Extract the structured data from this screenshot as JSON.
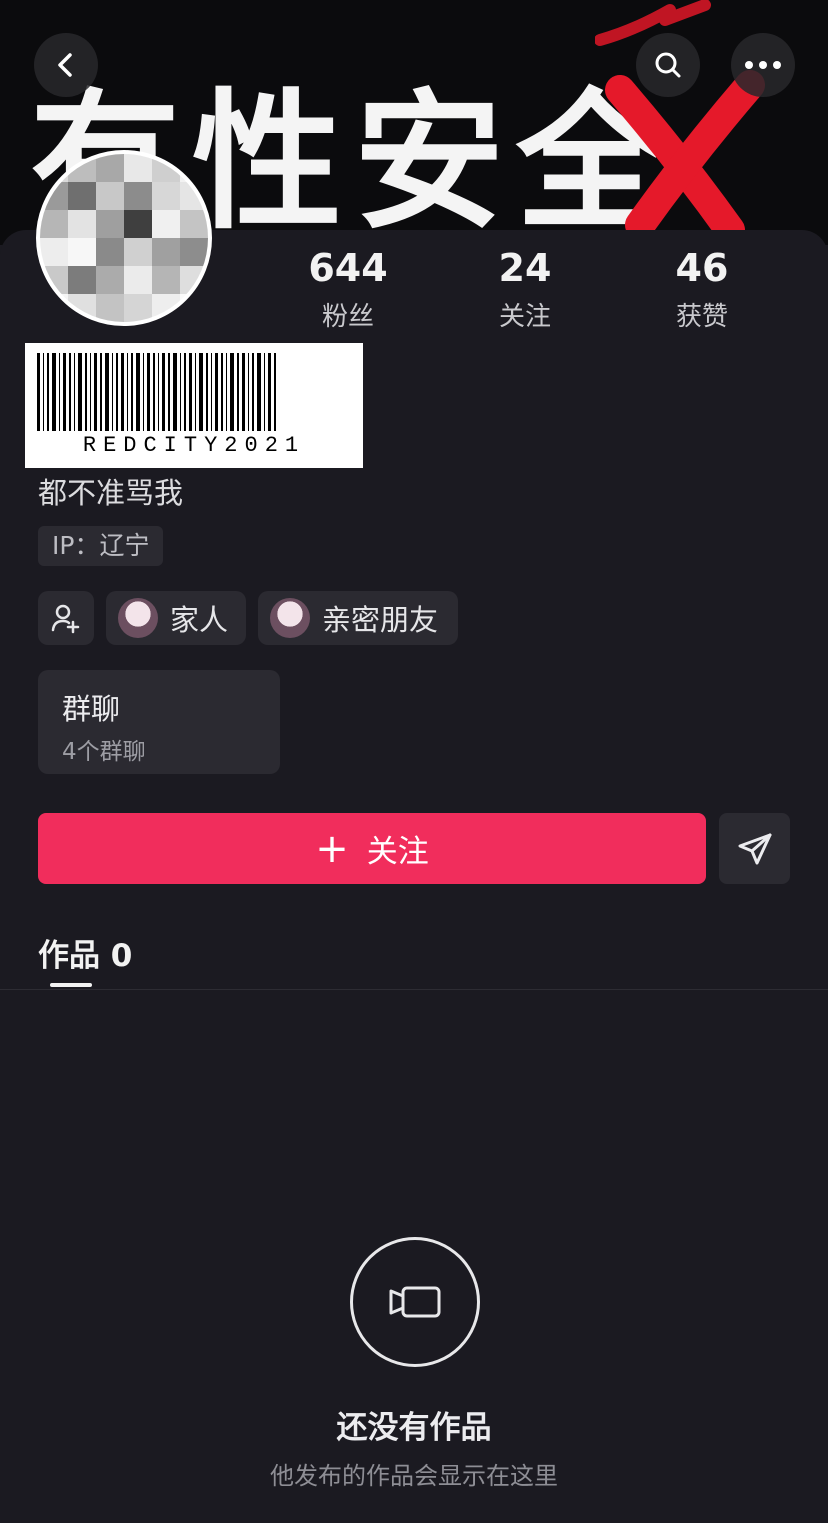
{
  "banner": {
    "text": "有性安全"
  },
  "stats": [
    {
      "value": "644",
      "label": "粉丝"
    },
    {
      "value": "24",
      "label": "关注"
    },
    {
      "value": "46",
      "label": "获赞"
    }
  ],
  "barcode": {
    "text": "REDCITY2021"
  },
  "profile": {
    "bio": "都不准骂我",
    "ip": "IP：辽宁"
  },
  "relations": {
    "family": "家人",
    "close_friends": "亲密朋友"
  },
  "group_chat": {
    "title": "群聊",
    "subtitle": "4个群聊"
  },
  "actions": {
    "follow_label": "关注",
    "follow_prefix": "+"
  },
  "tabs": {
    "works": "作品 0"
  },
  "empty": {
    "title": "还没有作品",
    "subtitle": "他发布的作品会显示在这里"
  },
  "colors": {
    "accent": "#f12d5c",
    "background": "#1b1a21",
    "chip": "#2b2a31"
  }
}
